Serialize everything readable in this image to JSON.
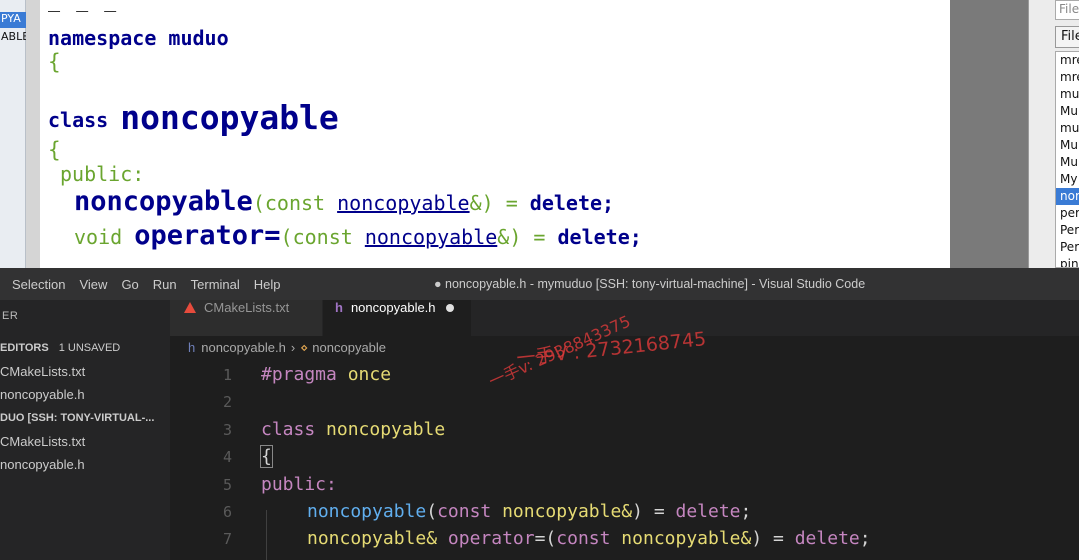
{
  "slide": {
    "left_selected_label": "PYA",
    "left_second_label": "ABLE",
    "partial_top_line": "_ _ _",
    "line1": "namespace muduo",
    "line2": "{",
    "line3_kw": "class ",
    "line3_name": "noncopyable",
    "line4": "{",
    "line5": "public:",
    "line6": {
      "fn": "noncopyable",
      "open": "(",
      "const": "const ",
      "type": "noncopyable",
      "amp": "&",
      "close": ") = ",
      "del": "delete",
      "semi": ";"
    },
    "line7": {
      "void": "void ",
      "op": "operator=",
      "open": "(",
      "const": "const ",
      "type": "noncopyable",
      "amp": "&",
      "close": ") = ",
      "del": "delete",
      "semi": ";"
    }
  },
  "right_pane": {
    "input_placeholder": "File",
    "button_label": "File",
    "files": [
      "mre",
      "mre",
      "mu",
      "Mu",
      "mu",
      "Mu",
      "Mu",
      "My",
      "nor",
      "per",
      "Per",
      "Per",
      "pin"
    ],
    "selected_index": 8
  },
  "vscode": {
    "menu": [
      "Selection",
      "View",
      "Go",
      "Run",
      "Terminal",
      "Help"
    ],
    "window_title": "● noncopyable.h - mymuduo [SSH: tony-virtual-machine] - Visual Studio Code",
    "sidebar": {
      "title": "ER",
      "open_editors_label": "EDITORS",
      "unsaved_label": "1 UNSAVED",
      "open_editors": [
        "CMakeLists.txt",
        "noncopyable.h"
      ],
      "workspace_label": "DUO [SSH: TONY-VIRTUAL-...",
      "workspace_files": [
        "CMakeLists.txt",
        "noncopyable.h"
      ]
    },
    "tabs": [
      {
        "label": "CMakeLists.txt",
        "icon": "cmake-icon"
      },
      {
        "label": "noncopyable.h",
        "icon": "h-file-icon",
        "dirty": true
      }
    ],
    "breadcrumb": {
      "file": "noncopyable.h",
      "symbol": "noncopyable"
    },
    "line_numbers": [
      "1",
      "2",
      "3",
      "4",
      "5",
      "6",
      "7"
    ],
    "code": {
      "l1_pp": "#pragma",
      "l1_once": " once",
      "l3_kw": "class",
      "l3_name": " noncopyable",
      "l4": "{",
      "l5": "public:",
      "l6_fn": "noncopyable",
      "l6_open": "(",
      "l6_const": "const",
      "l6_type": " noncopyable&",
      "l6_close": ") = ",
      "l6_del": "delete",
      "l6_semi": ";",
      "l7_type": "noncopyable&",
      "l7_sp": " ",
      "l7_op": "operator",
      "l7_eq": "=(",
      "l7_const": "const",
      "l7_type2": " noncopyable&",
      "l7_close": ") = ",
      "l7_del": "delete",
      "l7_semi": ";"
    },
    "watermarks": [
      "一手V : 2732168745",
      "一手v: 2938843375"
    ]
  }
}
